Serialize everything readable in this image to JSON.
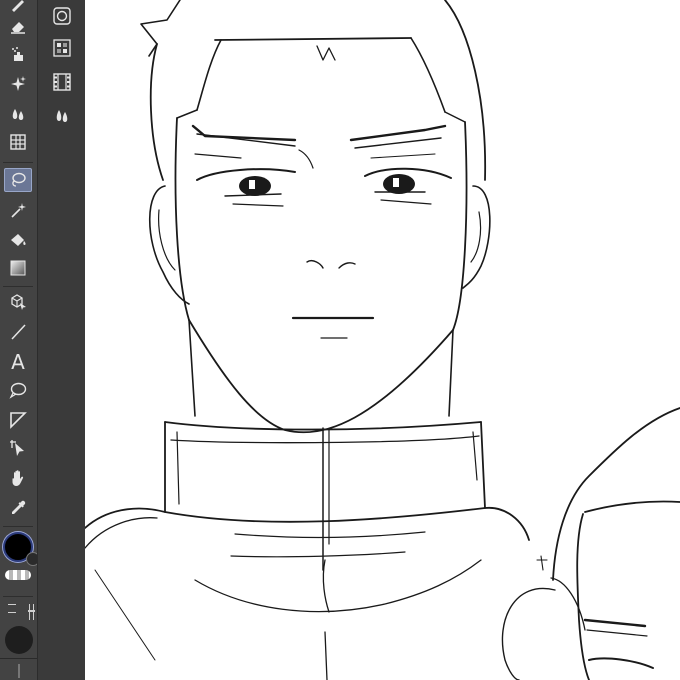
{
  "toolbar": {
    "text_tool_glyph": "A",
    "active_tool": "lasso-selection",
    "tools": [
      "pen",
      "eraser",
      "airbrush",
      "decoration",
      "blend",
      "grid",
      "lasso-selection",
      "auto-select",
      "fill",
      "gradient",
      "3d-object",
      "line",
      "text",
      "balloon",
      "ruler",
      "object-select",
      "hand",
      "eyedropper"
    ]
  },
  "colors": {
    "toolbar_bg": "#434343",
    "panel_bg": "#3a3a3a",
    "active_tool_bg": "#6b7796",
    "icon": "#e6e6e6",
    "main_color": "#000000",
    "canvas_bg": "#ffffff",
    "line_art": "#1a1a1a"
  }
}
